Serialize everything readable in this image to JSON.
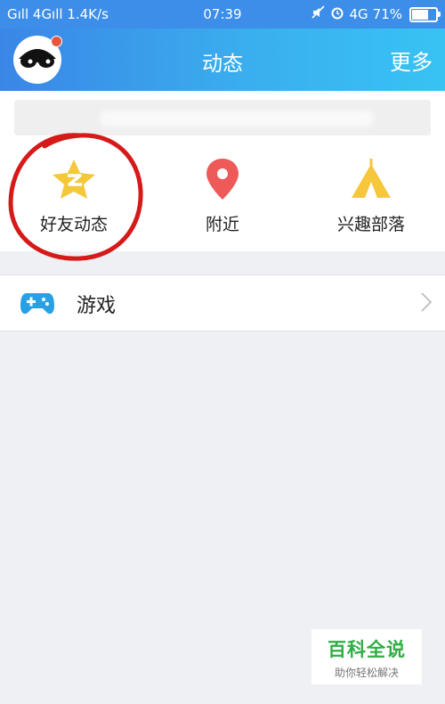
{
  "status_bar": {
    "left_text": "Gıll 4Gıll 1.4K/s",
    "time": "07:39",
    "network": "4G",
    "battery": "71%",
    "battery_level": 0.71
  },
  "header": {
    "title": "动态",
    "more_label": "更多"
  },
  "entries": [
    {
      "label": "好友动态",
      "icon": "qzone-star-icon"
    },
    {
      "label": "附近",
      "icon": "location-pin-icon"
    },
    {
      "label": "兴趣部落",
      "icon": "tent-icon"
    }
  ],
  "list": [
    {
      "label": "游戏",
      "icon": "gamepad-icon"
    }
  ],
  "watermark": {
    "title": "百科全说",
    "subtitle": "助你轻松解决"
  },
  "colors": {
    "header_start": "#3a86e6",
    "header_end": "#38c3f3",
    "star": "#f5c83a",
    "pin": "#ee5a59",
    "tent": "#f6c63c",
    "gamepad": "#2aa0e4",
    "annotation": "#d51a1a"
  }
}
